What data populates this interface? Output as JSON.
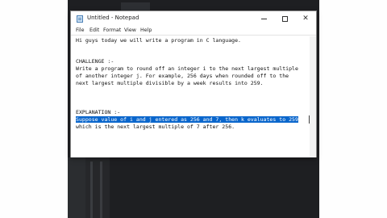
{
  "window": {
    "title": "Untitled - Notepad",
    "minimize_glyph": "",
    "maximize_glyph": "",
    "close_glyph": "✕"
  },
  "menu": [
    "File",
    "Edit",
    "Format",
    "View",
    "Help"
  ],
  "editor": {
    "lines": [
      "Hi guys today we will write a program in C language.",
      "CHALLENGE :-",
      "Write a program to round off an integer i to the next largest multiple",
      "of another integer j. For example, 256 days when rounded off to the",
      "next largest multiple divisible by a week results into 259.",
      "EXPLANATION :-",
      "Suppose value of i and j entered as 256 and 7, then k evaluates to 259",
      "which is the next largest multiple of 7 after 256."
    ]
  },
  "colors": {
    "selection": "#0a66cc",
    "ide_background": "#1e1f22"
  }
}
